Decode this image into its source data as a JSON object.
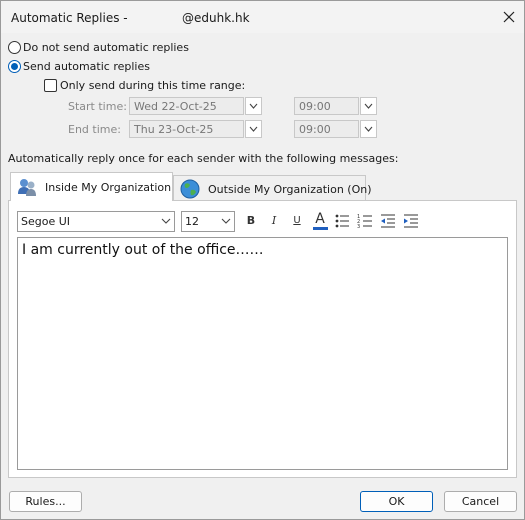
{
  "window": {
    "title": "Automatic Replies - ",
    "email": "@eduhk.hk"
  },
  "options": {
    "no_reply_label": "Do not send automatic replies",
    "send_reply_label": "Send automatic replies",
    "selected": "send",
    "time_range_label": "Only send during this time range:",
    "time_range_checked": false,
    "start_label": "Start time:",
    "start_date": "Wed 22-Oct-25",
    "start_time": "09:00",
    "end_label": "End time:",
    "end_date": "Thu 23-Oct-25",
    "end_time": "09:00"
  },
  "instruction": "Automatically reply once for each sender with the following messages:",
  "tabs": [
    {
      "label": "Inside My Organization",
      "active": true
    },
    {
      "label": "Outside My Organization (On)",
      "active": false
    }
  ],
  "toolbar": {
    "font": "Segoe UI",
    "size": "12",
    "bold": "B",
    "italic": "I",
    "underline": "U",
    "font_color": "A",
    "font_color_hex": "#1f5fbf"
  },
  "message": "I am currently out of the office……",
  "buttons": {
    "rules": "Rules...",
    "ok": "OK",
    "cancel": "Cancel"
  },
  "colors": {
    "accent": "#005fb8"
  }
}
